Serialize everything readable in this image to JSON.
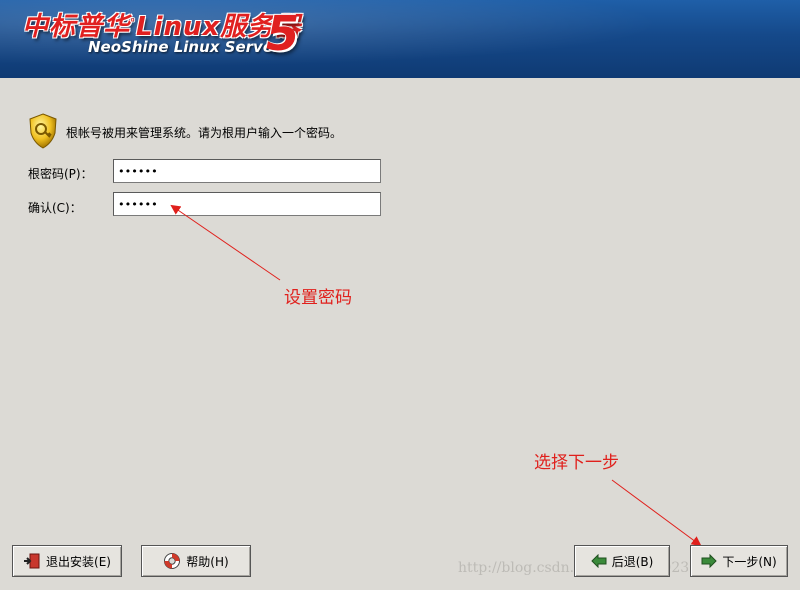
{
  "banner": {
    "logo_cn": "中标普华",
    "logo_linux": "Linux服务器",
    "logo_en": "NeoShine Linux Server",
    "logo_version": "5"
  },
  "info_text": "根帐号被用来管理系统。请为根用户输入一个密码。",
  "root_password": {
    "label": "根密码(P)：",
    "value": "••••••"
  },
  "confirm_password": {
    "label": "确认(C)：",
    "value": "••••••"
  },
  "annotations": {
    "set_password": "设置密码",
    "next_step": "选择下一步"
  },
  "buttons": {
    "exit": "退出安装(E)",
    "help": "帮助(H)",
    "back": "后退(B)",
    "next": "下一步(N)"
  },
  "watermark": "http://blog.csdn.net/gongzh1023",
  "colors": {
    "banner": "#15498a",
    "annotation": "#e0201c",
    "background": "#dcdad5"
  }
}
